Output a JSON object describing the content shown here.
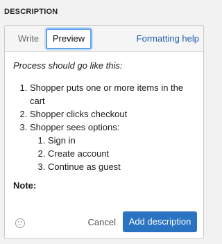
{
  "section": {
    "title": "DESCRIPTION"
  },
  "tabs": [
    {
      "label": "Write",
      "active": false
    },
    {
      "label": "Preview",
      "active": true
    }
  ],
  "help_link": "Formatting help",
  "preview": {
    "intro": "Process should go like this:",
    "steps": [
      "Shopper puts one or more items in the cart",
      "Shopper clicks checkout",
      "Shopper sees options:"
    ],
    "substeps": [
      "Sign in",
      "Create account",
      "Continue as guest"
    ],
    "note": "Note:"
  },
  "footer": {
    "emoji_icon": "smiley-icon",
    "cancel_label": "Cancel",
    "submit_label": "Add description"
  },
  "colors": {
    "primary_button": "#2a73c2",
    "link": "#1f5ea8",
    "focus_ring": "#5aa0f0"
  }
}
